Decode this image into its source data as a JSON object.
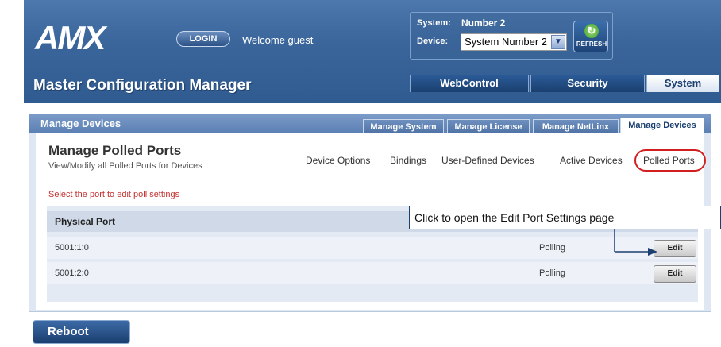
{
  "header": {
    "logo_text": "AMX",
    "login_label": "LOGIN",
    "welcome_text": "Welcome guest",
    "system_label": "System:",
    "system_value": "Number 2",
    "device_label": "Device:",
    "device_value": "System Number 2",
    "refresh_label": "REFRESH",
    "app_title": "Master Configuration Manager",
    "nav_tabs": [
      {
        "label": "WebControl"
      },
      {
        "label": "Security"
      },
      {
        "label": "System"
      }
    ]
  },
  "panel": {
    "title": "Manage Devices",
    "tabs": [
      {
        "label": "Manage System"
      },
      {
        "label": "Manage License"
      },
      {
        "label": "Manage NetLinx"
      },
      {
        "label": "Manage Devices"
      }
    ],
    "page_title": "Manage Polled Ports",
    "page_subtitle": "View/Modify all Polled Ports for Devices",
    "links": [
      {
        "label": "Device Options"
      },
      {
        "label": "Bindings"
      },
      {
        "label": "User-Defined Devices"
      },
      {
        "label": "Active Devices"
      },
      {
        "label": "Polled Ports"
      }
    ],
    "instruction": "Select the port to edit poll settings",
    "table": {
      "header": "Physical Port",
      "rows": [
        {
          "port": "5001:1:0",
          "status": "Polling",
          "action": "Edit"
        },
        {
          "port": "5001:2:0",
          "status": "Polling",
          "action": "Edit"
        }
      ]
    }
  },
  "callout": "Click to open the Edit Port Settings page",
  "reboot_label": "Reboot",
  "colors": {
    "header_blue": "#3a669c",
    "highlight_red": "#d21e1e",
    "instruction_red": "#c43131"
  }
}
